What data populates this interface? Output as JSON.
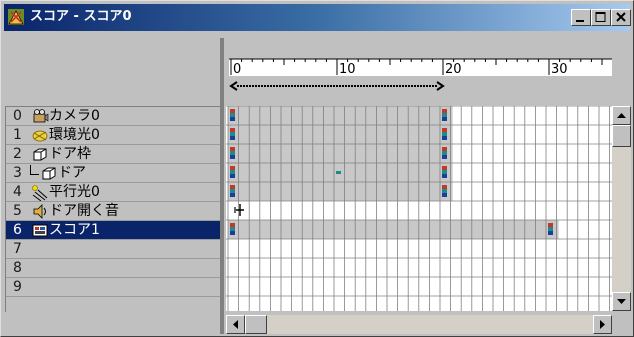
{
  "window": {
    "title": "スコア - スコア0"
  },
  "ruler": {
    "labels": [
      {
        "frame": 0,
        "text": "0"
      },
      {
        "frame": 10,
        "text": "10"
      },
      {
        "frame": 20,
        "text": "20"
      },
      {
        "frame": 30,
        "text": "30"
      }
    ]
  },
  "tracks": [
    {
      "num": "0",
      "name": "カメラ0",
      "icon": "camera-icon",
      "indent": 0
    },
    {
      "num": "1",
      "name": "環境光0",
      "icon": "ambient-light-icon",
      "indent": 0
    },
    {
      "num": "2",
      "name": "ドア枠",
      "icon": "cube-icon",
      "indent": 0
    },
    {
      "num": "3",
      "name": "ドア",
      "icon": "cube-icon",
      "indent": 1
    },
    {
      "num": "4",
      "name": "平行光0",
      "icon": "directional-light-icon",
      "indent": 0
    },
    {
      "num": "5",
      "name": "ドア開く音",
      "icon": "sound-icon",
      "indent": 0
    },
    {
      "num": "6",
      "name": "スコア1",
      "icon": "score-icon",
      "indent": 0,
      "selected": true
    },
    {
      "num": "7",
      "name": "",
      "icon": "",
      "indent": 0
    },
    {
      "num": "8",
      "name": "",
      "icon": "",
      "indent": 0
    },
    {
      "num": "9",
      "name": "",
      "icon": "",
      "indent": 0
    }
  ],
  "colors": {
    "title_gradient_start": "#0a246a",
    "title_gradient_end": "#a6caf0",
    "selected_row": "#0a246a",
    "active_cell": "#c8c8c8",
    "key_red": "#c0392b",
    "key_teal": "#1f8a8a",
    "key_blue": "#1a3e9c"
  }
}
